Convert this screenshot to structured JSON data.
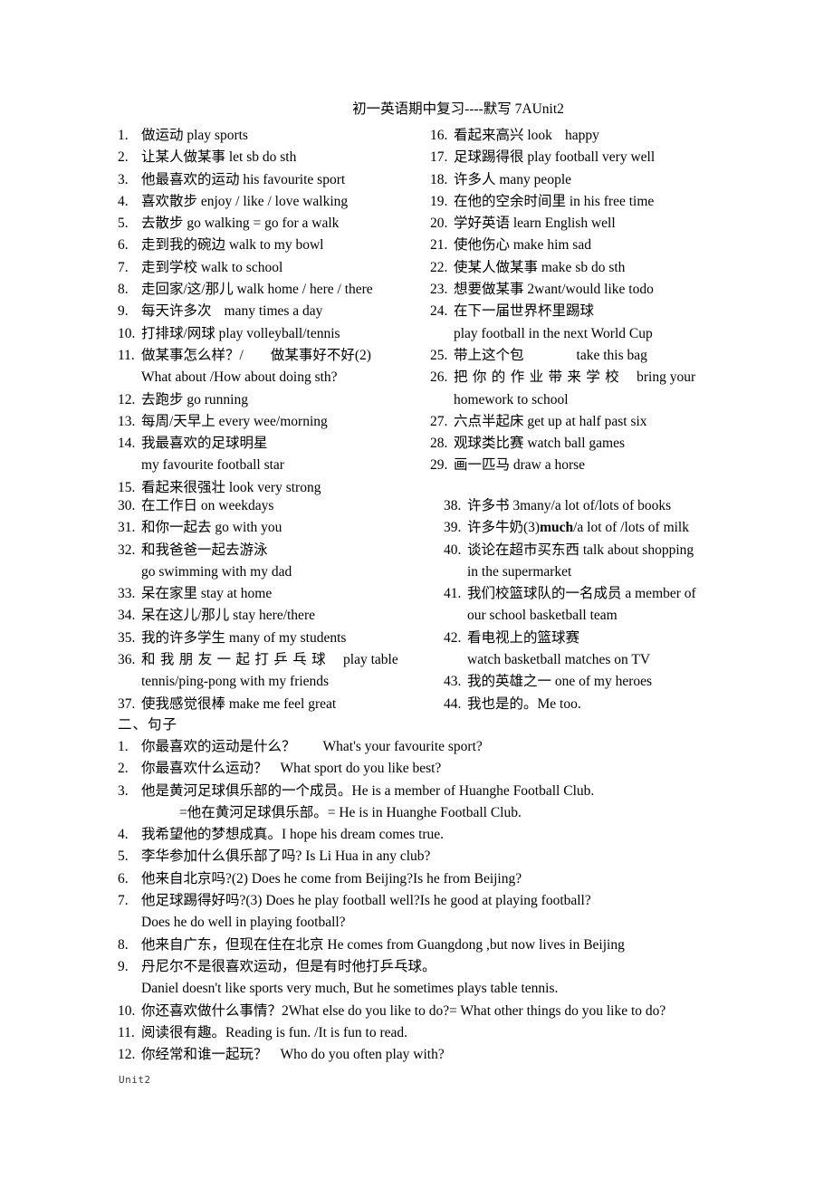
{
  "document": {
    "title": "初一英语期中复习----默写 7AUnit2",
    "footer": "Unit2"
  },
  "vocab_block_a": {
    "left": [
      {
        "num": "1.",
        "text": "做运动 play sports"
      },
      {
        "num": "2.",
        "text": "让某人做某事 let sb do sth"
      },
      {
        "num": "3.",
        "text": "他最喜欢的运动 his favourite sport"
      },
      {
        "num": "4.",
        "text": "喜欢散步 enjoy / like / love walking"
      },
      {
        "num": "5.",
        "text": "去散步 go walking = go for a walk"
      },
      {
        "num": "6.",
        "text": "走到我的碗边 walk to my bowl"
      },
      {
        "num": "7.",
        "text": "走到学校 walk to school"
      },
      {
        "num": "8.",
        "text": "走回家/这/那儿 walk home / here / there"
      },
      {
        "num": "9.",
        "text": "每天许多次",
        "gap": "gapsm",
        "text2": "many times a day"
      },
      {
        "num": "10.",
        "text": "打排球/网球 play volleyball/tennis"
      },
      {
        "num": "11.",
        "text": "做某事怎么样？/",
        "gap": "gapmd",
        "text2": "做某事好不好(2)",
        "cont": "What about /How about doing sth?"
      },
      {
        "num": "12.",
        "text": "去跑步 go running"
      },
      {
        "num": "13.",
        "text": "每周/天早上 every wee/morning"
      },
      {
        "num": "14.",
        "text": "我最喜欢的足球明星",
        "cont": "my favourite football star"
      },
      {
        "num": "15.",
        "text": "看起来很强壮 look very strong"
      }
    ],
    "right": [
      {
        "num": "16.",
        "text": "看起来高兴 look",
        "gap": "gapsm",
        "text2": "happy"
      },
      {
        "num": "17.",
        "text": "足球踢得很 play football very well"
      },
      {
        "num": "18.",
        "text": "许多人 many people"
      },
      {
        "num": "19.",
        "text": "在他的空余时间里 in his free time"
      },
      {
        "num": "20.",
        "text": "学好英语  learn English well"
      },
      {
        "num": "21.",
        "text": "使他伤心 make him sad"
      },
      {
        "num": "22.",
        "text": "使某人做某事 make sb do sth"
      },
      {
        "num": "23.",
        "text": "想要做某事  2want/would like todo"
      },
      {
        "num": "24.",
        "text": "在下一届世界杯里踢球",
        "cont": "play football in the next World Cup"
      },
      {
        "num": "25.",
        "text": "带上这个包",
        "gap": "gaplg",
        "text2": "take this bag"
      },
      {
        "num": "26.",
        "justified": true,
        "text": "把你的作业带来学校",
        "gap": "gapsm",
        "text2": "bring  your",
        "cont": "homework to school"
      },
      {
        "num": "27.",
        "text": "六点半起床 get up at half past six"
      },
      {
        "num": "28.",
        "text": "观球类比赛 watch ball games"
      },
      {
        "num": "29.",
        "text": "画一匹马 draw a horse"
      }
    ]
  },
  "vocab_block_b": {
    "left": [
      {
        "num": "30.",
        "text": "在工作日 on weekdays"
      },
      {
        "num": "31.",
        "text": "和你一起去 go with you"
      },
      {
        "num": "32.",
        "text": "和我爸爸一起去游泳",
        "cont": "go swimming with my dad"
      },
      {
        "num": "33.",
        "text": "呆在家里 stay at home"
      },
      {
        "num": "34.",
        "text": "呆在这儿/那儿 stay here/there"
      },
      {
        "num": "35.",
        "text": "我的许多学生 many of my students"
      },
      {
        "num": "36.",
        "justified": true,
        "text": "和我朋友一起打乒乓球",
        "gap": "gapsm",
        "text2": "play  table",
        "cont": "tennis/ping-pong with my friends"
      },
      {
        "num": "37.",
        "text": "使我感觉很棒 make me feel great"
      }
    ],
    "right": [
      {
        "num": "38.",
        "text": "许多书 3many/a lot of/lots of books"
      },
      {
        "num": "39.",
        "text_before": "许多牛奶(3)",
        "bold": "much",
        "text_after": "/a lot of /lots of milk"
      },
      {
        "num": "40.",
        "text": "谈论在超市买东西 talk about shopping",
        "cont": "in the supermarket"
      },
      {
        "num": "41.",
        "text": "我们校篮球队的一名成员 a member of",
        "cont": "our school basketball team"
      },
      {
        "num": "42.",
        "text": "看电视上的篮球赛",
        "cont": "watch basketball matches on TV"
      },
      {
        "num": "43.",
        "text": "我的英雄之一 one of my heroes"
      },
      {
        "num": "44.",
        "text": "我也是的。Me too."
      }
    ]
  },
  "sentences_section": {
    "heading": "二、句子",
    "items": [
      {
        "num": "1.",
        "text": "你最喜欢的运动是什么？",
        "gap": "gapmd",
        "text2": "What's your favourite sport?"
      },
      {
        "num": "2.",
        "text": "你最喜欢什么运动？",
        "gap": "gapsm",
        "text2": "What sport do you like best?"
      },
      {
        "num": "3.",
        "text": "他是黄河足球俱乐部的一个成员。He is a member of Huanghe Football Club.",
        "cont_indented": "=他在黄河足球俱乐部。= He is in Huanghe Football Club."
      },
      {
        "num": "4.",
        "text": "我希望他的梦想成真。I hope his dream comes true."
      },
      {
        "num": "5.",
        "text": "李华参加什么俱乐部了吗? Is Li Hua in any club?"
      },
      {
        "num": "6.",
        "text": "他来自北京吗?(2) Does he come from Beijing?Is he from Beijing?"
      },
      {
        "num": "7.",
        "text": "他足球踢得好吗?(3) Does he play football well?Is he good at playing football?",
        "cont": "Does he do well in playing football?"
      },
      {
        "num": "8.",
        "text": "他来自广东，但现在住在北京 He comes from Guangdong ,but now lives in Beijing"
      },
      {
        "num": "9.",
        "text": "丹尼尔不是很喜欢运动，但是有时他打乒乓球。",
        "cont": "Daniel doesn't like sports very much, But he sometimes plays table tennis."
      },
      {
        "num": "10.",
        "text": "你还喜欢做什么事情？2What else do you like to do?= What other things do you like to do?"
      },
      {
        "num": "11.",
        "text": "阅读很有趣。Reading is fun. /It is fun to read."
      },
      {
        "num": "12.",
        "text": "你经常和谁一起玩？",
        "gap": "gapsm",
        "text2": "Who do you often play with?"
      }
    ]
  }
}
